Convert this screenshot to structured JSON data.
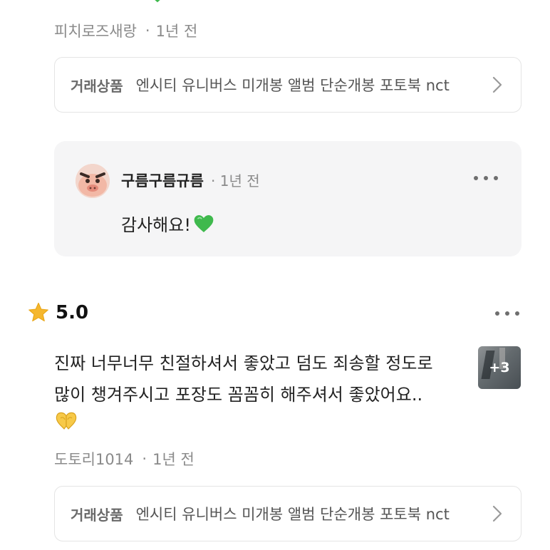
{
  "review1": {
    "cut_text": "",
    "author": "피치로즈새랑",
    "time": "1년 전",
    "product": {
      "label": "거래상품",
      "title": "엔시티 유니버스 미개봉 앨범 단순개봉 포토북 nct"
    }
  },
  "reply": {
    "author": "구름구름규름",
    "time": "1년 전",
    "text": "감사해요!",
    "icon": "green-heart-emoji"
  },
  "review2": {
    "score": "5.0",
    "star_color": "#F5B72E",
    "lines": [
      "진짜 너무너무 친절하셔서 좋았고 덤도 죄송할 정도로",
      "많이 챙겨주시고 포장도 꼼꼼히 해주셔서 좋았어요.."
    ],
    "emoji": "heart-hands-emoji",
    "photo_count": "+3",
    "author": "도토리1014",
    "time": "1년 전",
    "product": {
      "label": "거래상품",
      "title": "엔시티 유니버스 미개봉 앨범 단순개봉 포토북 nct"
    }
  }
}
